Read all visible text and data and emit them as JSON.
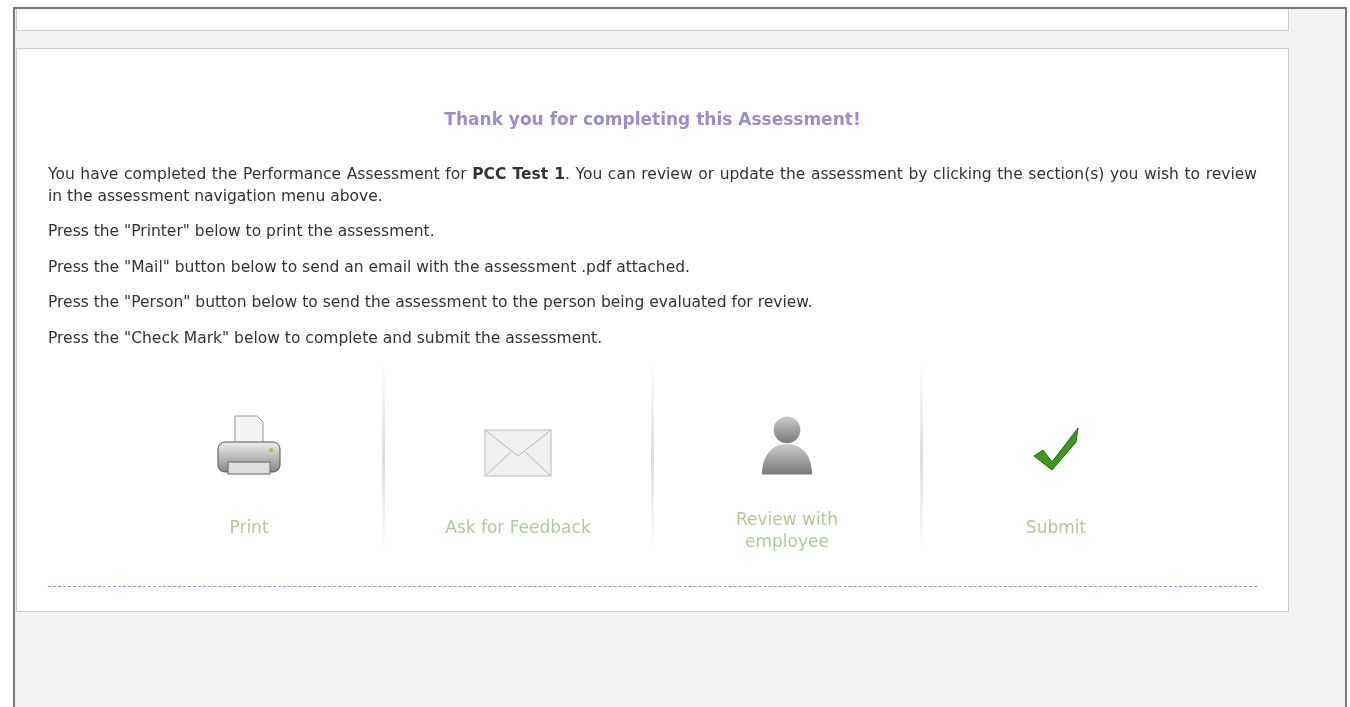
{
  "heading": "Thank you for completing this Assessment!",
  "paragraphs": [
    "You have completed the Performance Assessment for **PCC Test 1**. You can review or update the assessment by clicking the section(s) you wish to review in the assessment navigation menu above.",
    "Press the \"Printer\" below to print the assessment.",
    "Press the \"Mail\" button below to send an email with the assessment .pdf attached.",
    "Press the \"Person\" button below to send the assessment to the person being evaluated for review.",
    "Press the \"Check Mark\" below to complete and submit the assessment."
  ],
  "actions": [
    {
      "kind": "printer",
      "label": "Print"
    },
    {
      "kind": "mail",
      "label": "Ask for Feedback"
    },
    {
      "kind": "person",
      "label": "Review with employee"
    },
    {
      "kind": "check",
      "label": "Submit"
    }
  ]
}
